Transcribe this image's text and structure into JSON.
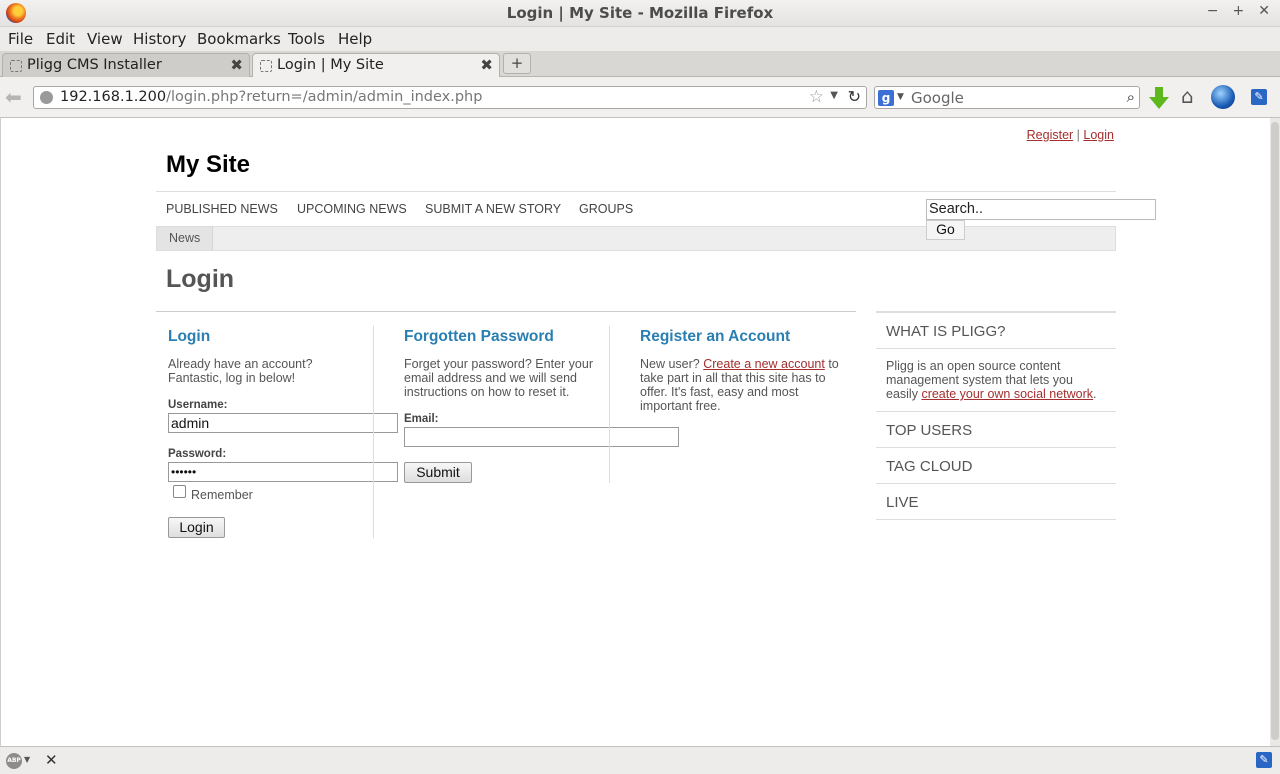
{
  "window": {
    "title": "Login | My Site - Mozilla Firefox"
  },
  "menu": [
    "File",
    "Edit",
    "View",
    "History",
    "Bookmarks",
    "Tools",
    "Help"
  ],
  "tabs": [
    {
      "label": "Pligg CMS Installer"
    },
    {
      "label": "Login | My Site"
    }
  ],
  "new_tab_label": "+",
  "toolbar": {
    "url_host": "192.168.1.200",
    "url_path": "/login.php?return=/admin/admin_index.php",
    "search_placeholder": "Google"
  },
  "site": {
    "top_links": {
      "register": "Register",
      "separator": "|",
      "login": "Login"
    },
    "title": "My Site",
    "nav": [
      "PUBLISHED NEWS",
      "UPCOMING NEWS",
      "SUBMIT A NEW STORY",
      "GROUPS"
    ],
    "subnav": [
      "News"
    ],
    "search_value": "Search..",
    "go_label": "Go"
  },
  "page": {
    "heading": "Login",
    "login": {
      "title": "Login",
      "intro": "Already have an account? Fantastic, log in below!",
      "username_label": "Username:",
      "username_value": "admin",
      "password_label": "Password:",
      "password_value": "••••••",
      "remember_label": "Remember",
      "button": "Login"
    },
    "forgot": {
      "title": "Forgotten Password",
      "intro": "Forget your password? Enter your email address and we will send instructions on how to reset it.",
      "email_label": "Email:",
      "email_value": "",
      "button": "Submit"
    },
    "register": {
      "title": "Register an Account",
      "intro_before": "New user? ",
      "intro_link": "Create a new account",
      "intro_after": " to take part in all that this site has to offer. It's fast, easy and most important free."
    }
  },
  "sidebar": {
    "what_is": {
      "title": "WHAT IS PLIGG?",
      "text_before": "Pligg is an open source content management system that lets you easily ",
      "link": "create your own social network",
      "text_after": "."
    },
    "sections": [
      "TOP USERS",
      "TAG CLOUD",
      "LIVE"
    ]
  },
  "icons": {
    "firefox": "firefox-logo-icon",
    "back": "back-arrow-icon",
    "download": "download-arrow-icon",
    "home": "home-icon",
    "addon": "blue-ball-icon",
    "abp": "adblock-icon"
  }
}
